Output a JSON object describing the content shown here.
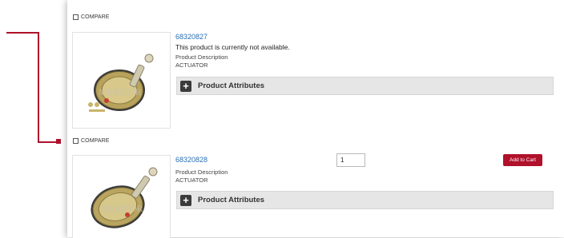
{
  "colors": {
    "link": "#2a6fb5",
    "accent": "#b0112b",
    "attr_bar_bg": "#e6e6e6"
  },
  "products": [
    {
      "compare_label": "COMPARE",
      "sku": "68320827",
      "availability": "This product is currently not available.",
      "description_label": "Product Description",
      "description_value": "ACTUATOR",
      "attributes_label": "Product Attributes",
      "image_icon": "brake-actuator-image"
    },
    {
      "compare_label": "COMPARE",
      "sku": "68320828",
      "description_label": "Product Description",
      "description_value": "ACTUATOR",
      "attributes_label": "Product Attributes",
      "quantity": "1",
      "add_to_cart_label": "Add to Cart",
      "image_icon": "brake-actuator-image"
    }
  ]
}
